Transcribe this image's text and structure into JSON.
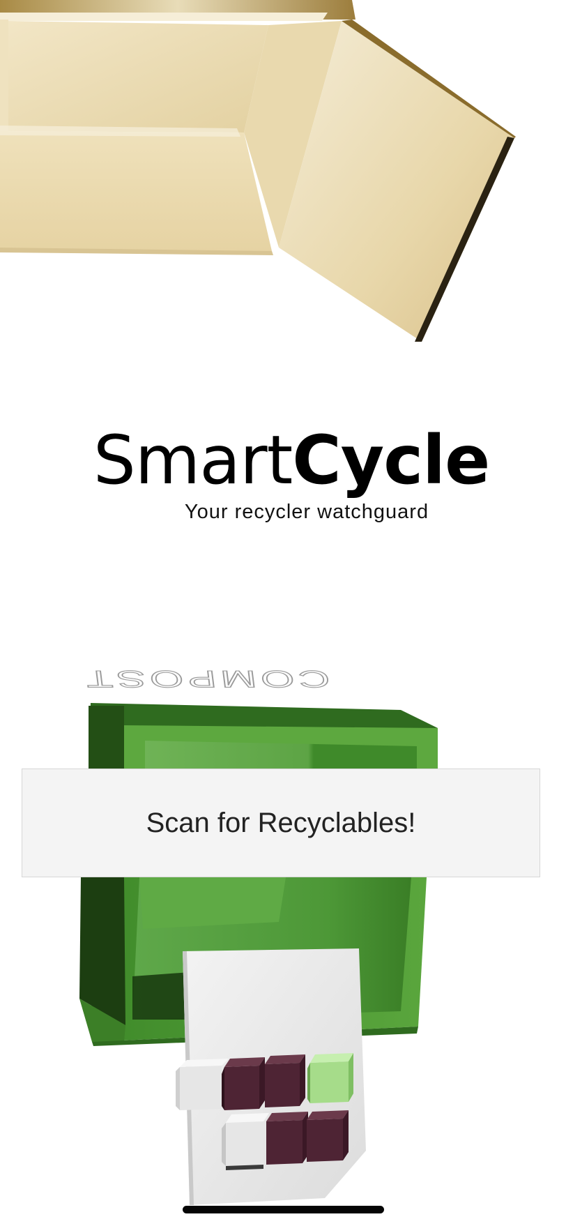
{
  "app": {
    "title_regular": "Smart",
    "title_bold": "Cycle",
    "tagline": "Your recycler watchguard"
  },
  "scene": {
    "bin_label": "COMPOST",
    "colors": {
      "cardboard": "#e8d9b0",
      "compost_bin": "#4f9a34",
      "bin_dark": "#1f4a14",
      "item_dark": "#4e2434",
      "item_light_green": "#a6dc8a",
      "item_white": "#e3e3e3"
    }
  },
  "actions": {
    "scan_label": "Scan for Recyclables!"
  }
}
